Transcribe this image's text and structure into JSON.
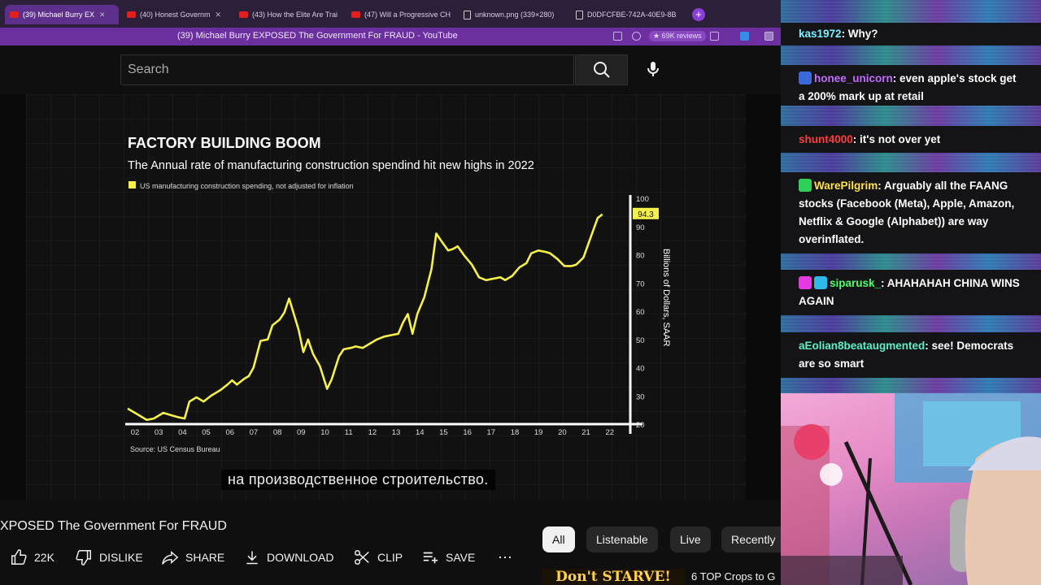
{
  "browser": {
    "tabs": [
      {
        "label": "(39) Michael Burry EX",
        "active": true,
        "icon": "youtube-icon"
      },
      {
        "label": "(40) Honest Governm",
        "active": false,
        "icon": "youtube-icon"
      },
      {
        "label": "(43) How the Elite Are Trai",
        "active": false,
        "icon": "youtube-icon"
      },
      {
        "label": "(47) Will a Progressive CH",
        "active": false,
        "icon": "youtube-icon"
      },
      {
        "label": "unknown.png (339×280)",
        "active": false,
        "icon": "document-icon"
      },
      {
        "label": "D0DFCFBE-742A-40E9-8B",
        "active": false,
        "icon": "document-icon"
      }
    ],
    "window_title": "(39) Michael Burry EXPOSED The Government For FRAUD - YouTube",
    "reviews_badge": "★ 69K reviews"
  },
  "youtube": {
    "search_placeholder": "Search",
    "subtitle": "на производственное строительство.",
    "video_title": "XPOSED The Government For FRAUD",
    "actions": {
      "likes": "22K",
      "dislike": "DISLIKE",
      "share": "SHARE",
      "download": "DOWNLOAD",
      "clip": "CLIP",
      "save": "SAVE"
    },
    "chips": [
      "All",
      "Listenable",
      "Live",
      "Recently"
    ],
    "recommended": {
      "thumb_text": "Don't STARVE!",
      "title": "6 TOP Crops to G"
    }
  },
  "chart_data": {
    "type": "line",
    "title": "FACTORY BUILDING BOOM",
    "subtitle": "The Annual rate of manufacturing construction spendind hit new highs in 2022",
    "legend": "US manufacturing construction spending, not adjusted for inflation",
    "ylabel": "Billions of Dollars, SAAR",
    "source": "Source: US Census Bureau",
    "x_tick_labels": [
      "02",
      "03",
      "04",
      "05",
      "06",
      "07",
      "08",
      "09",
      "10",
      "11",
      "12",
      "13",
      "14",
      "15",
      "16",
      "17",
      "18",
      "19",
      "20",
      "21",
      "22"
    ],
    "y_ticks": [
      20,
      30,
      40,
      50,
      60,
      70,
      80,
      90,
      100
    ],
    "ylim": [
      20,
      100
    ],
    "xlim": [
      2002,
      2022.9
    ],
    "last_value_label": "94.3",
    "color": "#f5f04a",
    "series": [
      {
        "x": [
          2002.0,
          2002.4,
          2002.8,
          2003.1,
          2003.5,
          2003.9,
          2004.1,
          2004.4,
          2004.6,
          2004.9,
          2005.2,
          2005.5,
          2005.9,
          2006.2,
          2006.4,
          2006.6,
          2006.9,
          2007.1,
          2007.3,
          2007.6,
          2007.9,
          2008.1,
          2008.4,
          2008.6,
          2008.8,
          2009.0,
          2009.2,
          2009.4,
          2009.6,
          2009.8,
          2010.1,
          2010.4,
          2010.6,
          2010.9,
          2011.1,
          2011.4,
          2011.6,
          2011.9,
          2012.2,
          2012.5,
          2012.8,
          2013.1,
          2013.4,
          2013.6,
          2013.8,
          2014.0,
          2014.2,
          2014.5,
          2014.8,
          2015.0,
          2015.2,
          2015.5,
          2015.7,
          2015.9,
          2016.2,
          2016.5,
          2016.8,
          2017.1,
          2017.4,
          2017.7,
          2017.9,
          2018.2,
          2018.5,
          2018.8,
          2019.0,
          2019.3,
          2019.6,
          2019.8,
          2020.1,
          2020.4,
          2020.7,
          2020.9,
          2021.2,
          2021.5,
          2021.8,
          2022.0
        ],
        "y": [
          25.5,
          23.5,
          21.5,
          22,
          24,
          23,
          22.5,
          22,
          28,
          29.5,
          28,
          30,
          32,
          34,
          35.5,
          34,
          36,
          37,
          40,
          49.5,
          50,
          55,
          57,
          59.5,
          64.5,
          59,
          53.5,
          45.5,
          50,
          45,
          40.5,
          32.5,
          36,
          44,
          46.5,
          47,
          47.5,
          47,
          48.5,
          50,
          51,
          51.5,
          52,
          56,
          59,
          52,
          59,
          65,
          75,
          87.5,
          85,
          81.5,
          82,
          83,
          79.5,
          76.5,
          72,
          71,
          71.5,
          72,
          71,
          72.5,
          75.5,
          77,
          80.5,
          81.5,
          81,
          80.5,
          78.5,
          76,
          76,
          76.5,
          79,
          86,
          93,
          94.3
        ]
      }
    ]
  },
  "chat": {
    "messages": [
      {
        "user": "kas1972",
        "text": ": Why?",
        "color": "#7cf0ff",
        "badges": []
      },
      {
        "user": "honee_unicorn",
        "text": ": even apple's stock get a 200% mark up at retail",
        "color": "#c26bff",
        "badges": [
          "#3a6ad8"
        ]
      },
      {
        "user": "shunt4000",
        "text": ": it's not over yet",
        "color": "#ff3b3b",
        "badges": []
      },
      {
        "user": "WarePilgrim",
        "text": ": Arguably all the FAANG stocks (Facebook (Meta), Apple, Amazon, Netflix & Google (Alphabet)) are way overinflated.",
        "color": "#ffe14a",
        "badges": [
          "#2fcf5a"
        ]
      },
      {
        "user": "siparusk_",
        "text": ": AHAHAHAH CHINA WINS AGAIN",
        "color": "#4cff6a",
        "badges": [
          "#e23ce0",
          "#2fb8e8"
        ]
      },
      {
        "user": "aEolian8beataugmented",
        "text": ": see! Democrats are so smart",
        "color": "#5cf0c6",
        "badges": []
      }
    ]
  }
}
